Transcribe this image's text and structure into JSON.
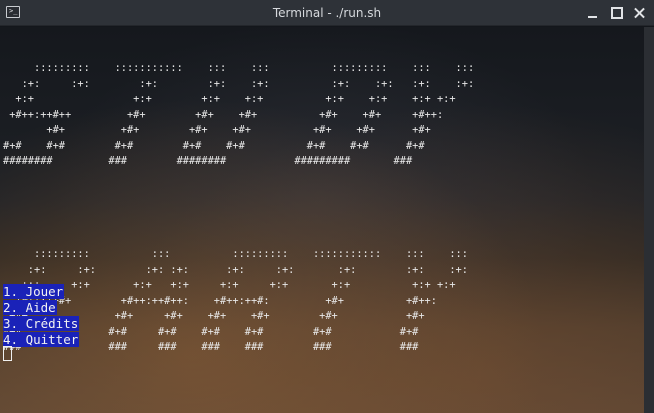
{
  "window": {
    "title": "Terminal - ./run.sh",
    "app_icon": "terminal-icon",
    "app_icon_glyph": ">_"
  },
  "ascii_art": {
    "block1": "     :::::::::    :::::::::::    :::    :::          :::::::::    :::    :::\n   :+:     :+:        :+:        :+:    :+:          :+:    :+:   :+:    :+:\n  +:+                +:+        +:+    +:+          +:+    +:+    +:+ +:+\n +#++:++#++         +#+        +#+    +#+          +#+    +#+     +#++:\n       +#+         +#+        +#+    +#+          +#+    +#+      +#+\n#+#    #+#        #+#        #+#    #+#          #+#    #+#      #+#\n########         ###        ########           #########       ###",
    "block2": "     :::::::::          :::          :::::::::    :::::::::::    :::    :::\n    :+:     :+:        :+: :+:      :+:     :+:       :+:        :+:    :+:\n   +:+     +:+       +:+   +:+     +:+     +:+       +:+          +:+ +:+\n  +#++:++#+        +#++:++#++:    +#++:++#:         +#+          +#++:\n +#+              +#+     +#+    +#+    +#+        +#+           +#+\n#+#              #+#     #+#    #+#    #+#        #+#           #+#\n###              ###     ###    ###    ###        ###           ###"
  },
  "menu": {
    "items": [
      {
        "label": "1. Jouer"
      },
      {
        "label": "2. Aide"
      },
      {
        "label": "3. Crédits"
      },
      {
        "label": "4. Quitter"
      }
    ],
    "highlight_color": "#1a22b8"
  }
}
